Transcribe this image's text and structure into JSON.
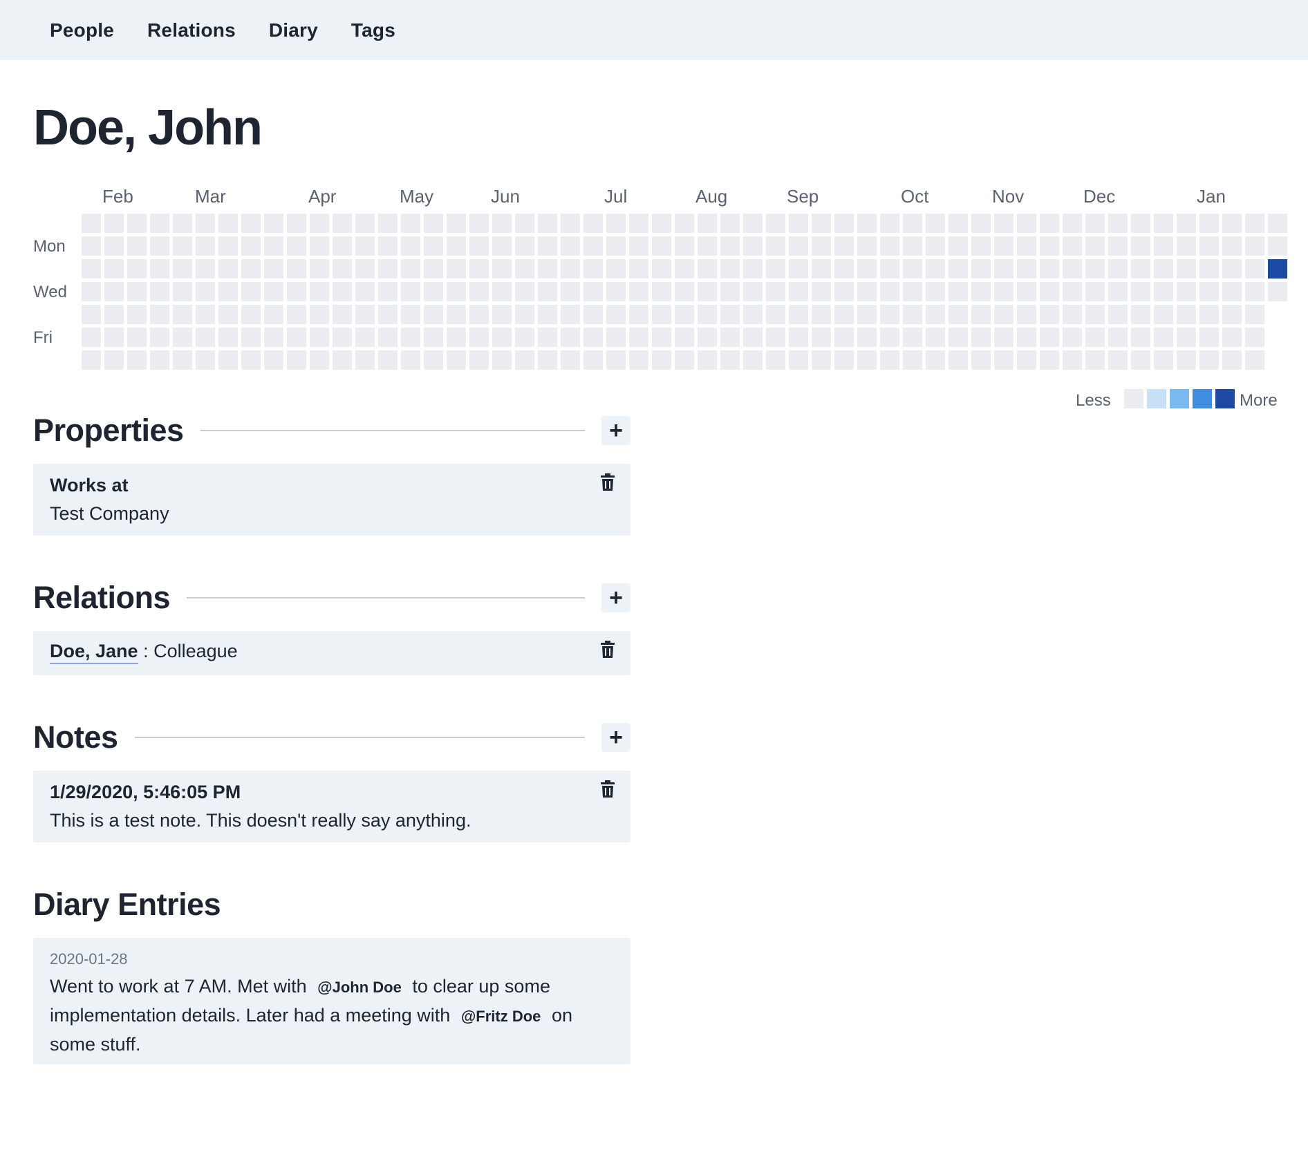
{
  "nav": {
    "items": [
      "People",
      "Relations",
      "Diary",
      "Tags"
    ]
  },
  "person": {
    "name": "Doe, John"
  },
  "heatmap": {
    "months": [
      "Feb",
      "Mar",
      "Apr",
      "May",
      "Jun",
      "Jul",
      "Aug",
      "Sep",
      "Oct",
      "Nov",
      "Dec",
      "Jan"
    ],
    "day_labels": [
      "Mon",
      "Wed",
      "Fri"
    ],
    "weeks": 53,
    "last_week_days": 4,
    "active_cells": [
      {
        "week": 52,
        "day": 2,
        "level": 4
      }
    ],
    "legend": {
      "less": "Less",
      "more": "More",
      "colors": [
        "#ebedf0",
        "#c6e0f7",
        "#7ab8f0",
        "#3e8de0",
        "#1b49a3"
      ]
    }
  },
  "properties": {
    "title": "Properties",
    "add_label": "+",
    "items": [
      {
        "label": "Works at",
        "value": "Test Company"
      }
    ]
  },
  "relations": {
    "title": "Relations",
    "add_label": "+",
    "items": [
      {
        "name": "Doe, Jane",
        "separator": " : ",
        "type": "Colleague"
      }
    ]
  },
  "notes": {
    "title": "Notes",
    "add_label": "+",
    "items": [
      {
        "timestamp": "1/29/2020, 5:46:05 PM",
        "text": "This is a test note. This doesn't really say anything."
      }
    ]
  },
  "diary": {
    "title": "Diary Entries",
    "entries": [
      {
        "date": "2020-01-28",
        "text_1": "Went to work at 7 AM. Met with",
        "mention_1": "@John Doe",
        "text_2": "to clear up some implementation details. Later had a meeting with",
        "mention_2": "@Fritz Doe",
        "text_3": "on some stuff."
      }
    ]
  },
  "colors": {
    "accent": "#1b49a3",
    "card_bg": "#edf2f7",
    "empty_cell": "#ebedf0"
  }
}
